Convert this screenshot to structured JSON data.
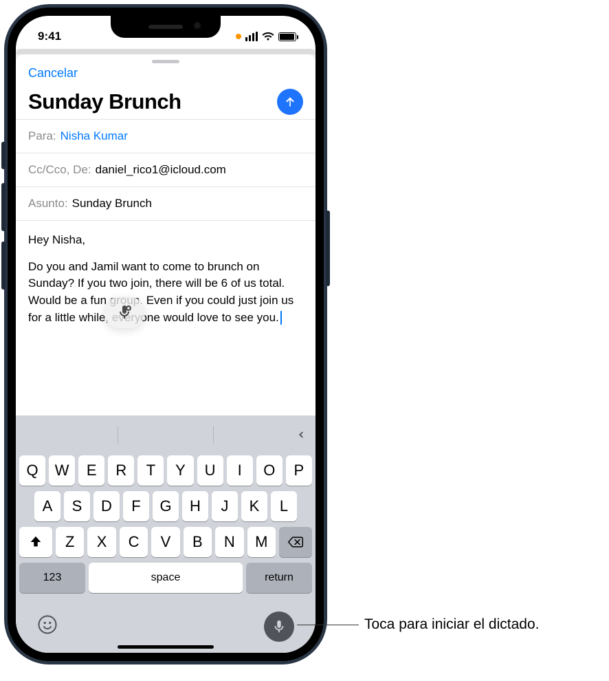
{
  "status": {
    "time": "9:41"
  },
  "sheet": {
    "cancel": "Cancelar",
    "title": "Sunday Brunch"
  },
  "fields": {
    "to_label": "Para:",
    "to_value": "Nisha Kumar",
    "cc_label": "Cc/Cco, De:",
    "cc_value": "daniel_rico1@icloud.com",
    "subject_label": "Asunto:",
    "subject_value": "Sunday Brunch"
  },
  "body": {
    "greeting": "Hey Nisha,",
    "paragraph": "Do you and Jamil want to come to brunch on Sunday? If you two join, there will be 6 of us total. Would be a fun group. Even if you could just join us for a little while, everyone would love to see you."
  },
  "keyboard": {
    "row1": [
      "Q",
      "W",
      "E",
      "R",
      "T",
      "Y",
      "U",
      "I",
      "O",
      "P"
    ],
    "row2": [
      "A",
      "S",
      "D",
      "F",
      "G",
      "H",
      "J",
      "K",
      "L"
    ],
    "row3": [
      "Z",
      "X",
      "C",
      "V",
      "B",
      "N",
      "M"
    ],
    "num": "123",
    "space": "space",
    "return": "return"
  },
  "callout": {
    "text": "Toca para iniciar el dictado."
  }
}
